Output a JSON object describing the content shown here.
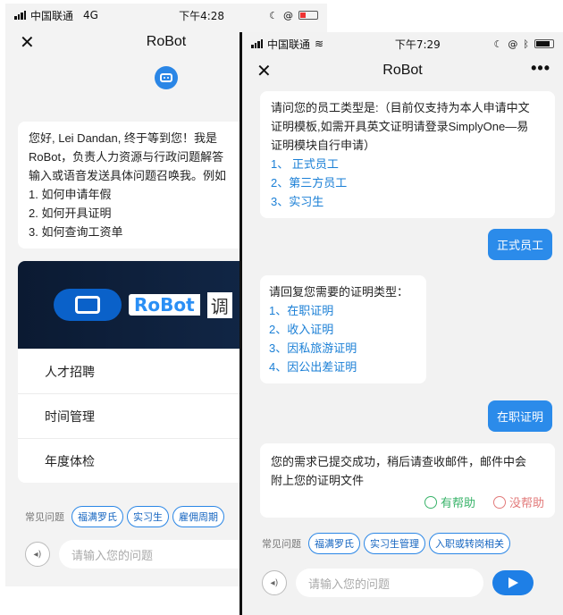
{
  "phone1": {
    "status": {
      "carrier": "中国联通",
      "network": "4G",
      "time": "下午4:28"
    },
    "nav": {
      "title": "RoBot"
    },
    "greeting": {
      "lines": [
        "您好, Lei Dandan, 终于等到您！我是",
        "RoBot，负责人力资源与行政问题解答",
        "输入或语音发送具体问题召唤我。例如",
        "1. 如何申请年假",
        "2. 如何开具证明",
        "3. 如何查询工资单"
      ]
    },
    "banner": {
      "logo_text": "RoBot",
      "extra_text": "调"
    },
    "menu": [
      "人才招聘",
      "时间管理",
      "年度体检"
    ],
    "faq": {
      "label": "常见问题",
      "chips": [
        "福满罗氏",
        "实习生",
        "雇佣周期"
      ]
    },
    "input": {
      "placeholder": "请输入您的问题"
    }
  },
  "phone2": {
    "status": {
      "carrier": "中国联通",
      "time": "下午7:29"
    },
    "nav": {
      "title": "RoBot",
      "more": "•••"
    },
    "bot1": {
      "lines": [
        "请问您的员工类型是:（目前仅支持为本人申请中文",
        "证明模板,如需开具英文证明请登录SimplyOne—易",
        "证明模块自行申请）"
      ],
      "options": [
        "1、 正式员工",
        "2、第三方员工",
        "3、实习生"
      ]
    },
    "user1": "正式员工",
    "bot2": {
      "lines": [
        "请回复您需要的证明类型："
      ],
      "options": [
        "1、在职证明",
        "2、收入证明",
        "3、因私旅游证明",
        "4、因公出差证明"
      ]
    },
    "user2": "在职证明",
    "bot3": {
      "lines": [
        "您的需求已提交成功，稍后请查收邮件，邮件中会",
        "附上您的证明文件"
      ],
      "helpful": "有帮助",
      "not_helpful": "没帮助"
    },
    "faq": {
      "label": "常见问题",
      "chips": [
        "福满罗氏",
        "实习生管理",
        "入职或转岗相关"
      ]
    },
    "input": {
      "placeholder": "请输入您的问题"
    }
  },
  "colors": {
    "accent": "#2b8bea",
    "helpful": "#39b36a",
    "not_helpful": "#e27a7a"
  }
}
